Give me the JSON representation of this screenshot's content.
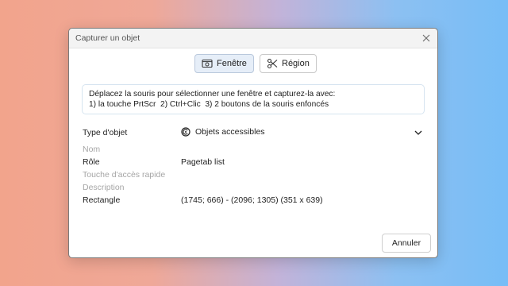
{
  "dialog": {
    "title": "Capturer un objet",
    "close_icon": "close-icon"
  },
  "modes": [
    {
      "label": "Fenêtre",
      "icon": "camera-window-icon",
      "active": true
    },
    {
      "label": "Région",
      "icon": "scissors-icon",
      "active": false
    }
  ],
  "instructions": {
    "line1": "Déplacez la souris pour sélectionner une fenêtre et capturez-la avec:",
    "line2": "1) la touche PrtScr  2) Ctrl+Clic  3) 2 boutons de la souris enfoncés"
  },
  "object_type": {
    "label": "Type d'objet",
    "value": "Objets accessibles",
    "icon": "accessibility-object-icon",
    "dropdown_icon": "chevron-down-icon"
  },
  "properties": [
    {
      "label": "Nom",
      "value": "",
      "enabled": false
    },
    {
      "label": "Rôle",
      "value": "Pagetab list",
      "enabled": true
    },
    {
      "label": "Touche d'accès rapide",
      "value": "",
      "enabled": false
    },
    {
      "label": "Description",
      "value": "",
      "enabled": false
    },
    {
      "label": "Rectangle",
      "value": "(1745; 666) - (2096; 1305) (351 x 639)",
      "enabled": true
    }
  ],
  "buttons": {
    "cancel": "Annuler"
  }
}
